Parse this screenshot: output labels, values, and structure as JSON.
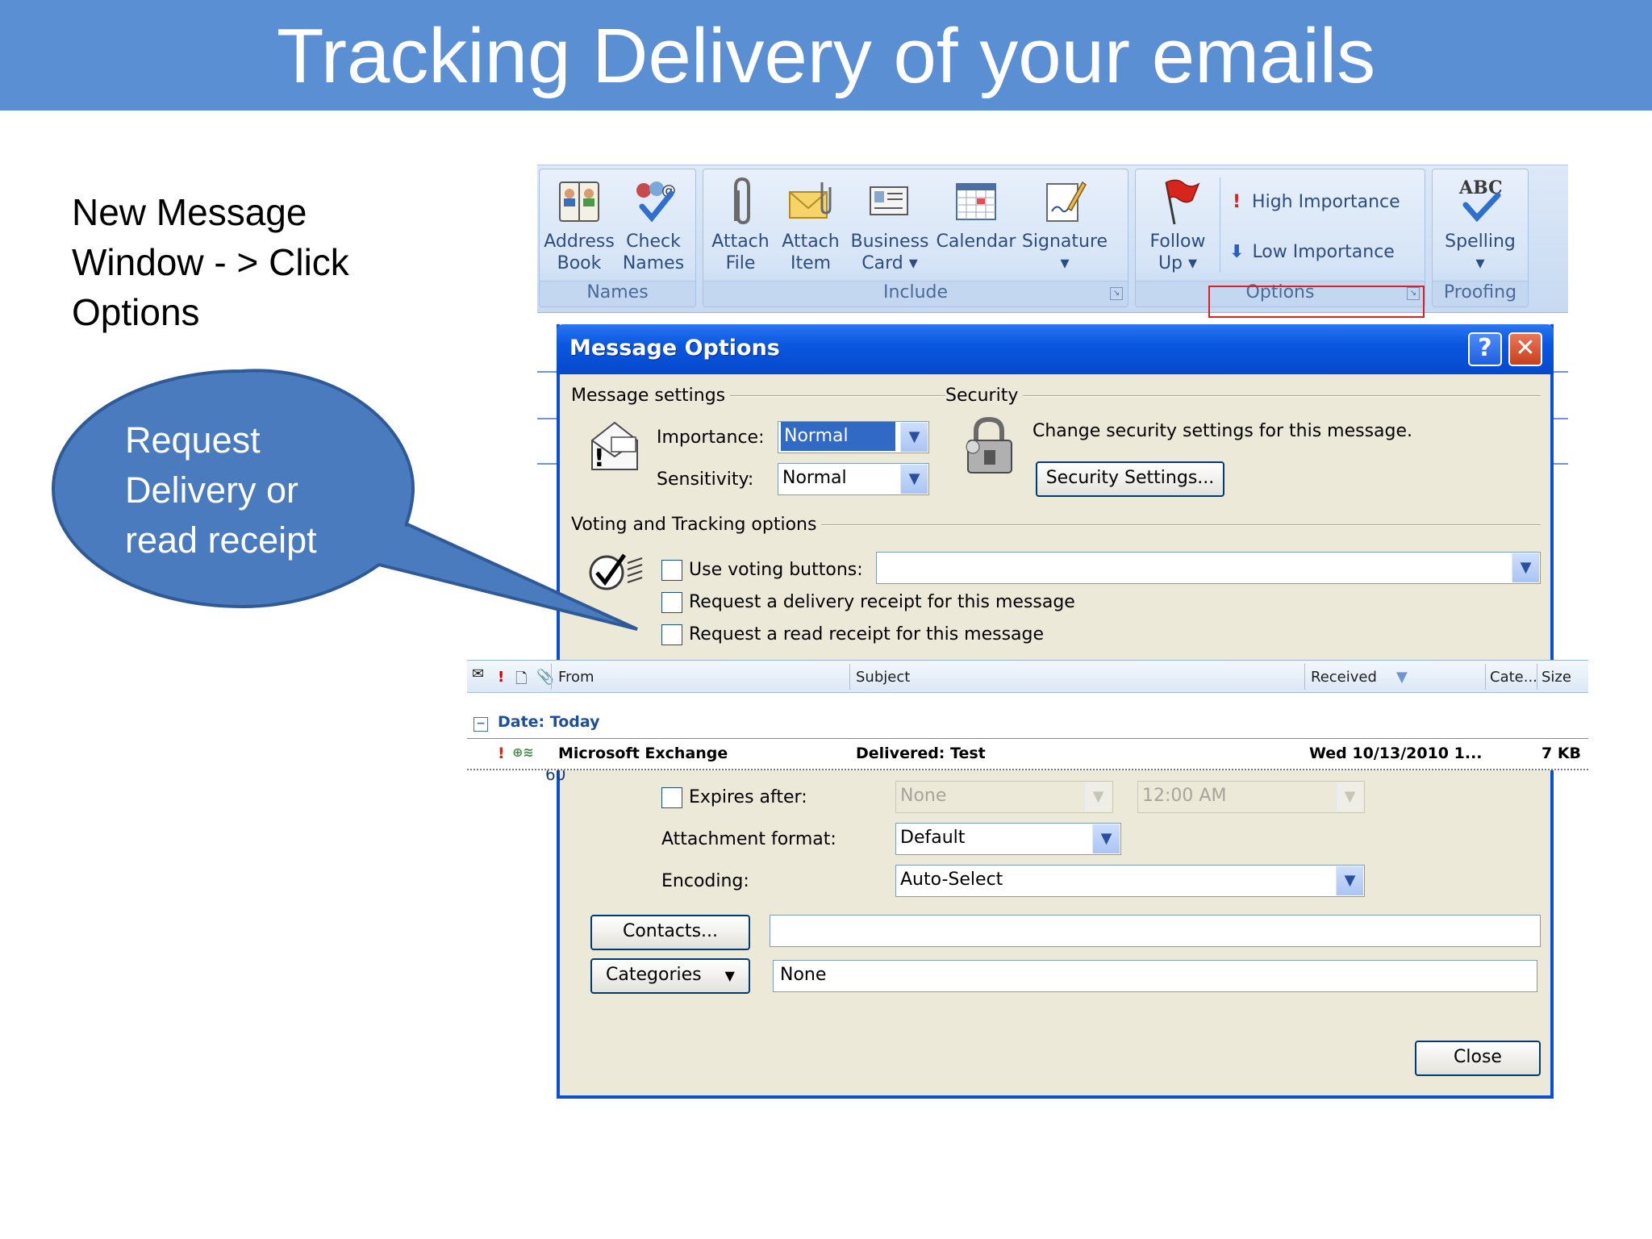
{
  "slide": {
    "title": "Tracking Delivery of your emails",
    "note_lines": [
      "New Message",
      "Window - > Click",
      "Options"
    ],
    "callout_lines": [
      "Request",
      "Delivery or",
      "read receipt"
    ]
  },
  "ribbon": {
    "names_group": {
      "label": "Names",
      "buttons": [
        {
          "line1": "Address",
          "line2": "Book",
          "icon": "address-book-icon"
        },
        {
          "line1": "Check",
          "line2": "Names",
          "icon": "check-names-icon"
        }
      ]
    },
    "include_group": {
      "label": "Include",
      "buttons": [
        {
          "line1": "Attach",
          "line2": "File",
          "icon": "paperclip-icon"
        },
        {
          "line1": "Attach",
          "line2": "Item",
          "icon": "envelope-icon"
        },
        {
          "line1": "Business",
          "line2": "Card ▾",
          "icon": "business-card-icon"
        },
        {
          "line1": "Calendar",
          "line2": "",
          "icon": "calendar-icon"
        },
        {
          "line1": "Signature",
          "line2": "▾",
          "icon": "signature-icon"
        }
      ]
    },
    "options_group": {
      "label": "Options",
      "follow_up": {
        "line1": "Follow",
        "line2": "Up ▾",
        "icon": "flag-icon"
      },
      "high_importance": "High Importance",
      "low_importance": "Low Importance"
    },
    "proofing_group": {
      "label": "Proofing",
      "spelling": {
        "line1": "Spelling",
        "line2": "▾",
        "icon": "abc-check-icon"
      }
    }
  },
  "dialog": {
    "title": "Message Options",
    "help": "?",
    "close_glyph": "✕",
    "message_settings": {
      "heading": "Message settings",
      "importance_label": "Importance:",
      "importance_value": "Normal",
      "sensitivity_label": "Sensitivity:",
      "sensitivity_value": "Normal"
    },
    "security": {
      "heading": "Security",
      "description": "Change security settings for this message.",
      "button": "Security Settings..."
    },
    "voting": {
      "heading": "Voting and Tracking options",
      "use_voting": "Use voting buttons:",
      "delivery_receipt": "Request a delivery receipt for this message",
      "read_receipt": "Request a read receipt for this message"
    },
    "delivery": {
      "partial_text": "60",
      "expires_label": "Expires after:",
      "expires_date": "None",
      "expires_time": "12:00 AM",
      "attachment_label": "Attachment format:",
      "attachment_value": "Default",
      "encoding_label": "Encoding:",
      "encoding_value": "Auto-Select"
    },
    "contacts_button": "Contacts...",
    "categories_button": "Categories",
    "categories_value": "None",
    "close_button": "Close"
  },
  "inbox": {
    "columns": [
      "From",
      "Subject",
      "Received",
      "Cate...",
      "Size"
    ],
    "group": "Date: Today",
    "row": {
      "from": "Microsoft Exchange",
      "subject": "Delivered: Test",
      "received": "Wed 10/13/2010 1...",
      "size": "7 KB"
    }
  },
  "colors": {
    "header_blue": "#5b8fd4",
    "callout_blue": "#4a7bbf",
    "xp_titlebar": "#0a58e0",
    "dialog_face": "#ece9d8",
    "highlight_red": "#e02020"
  }
}
